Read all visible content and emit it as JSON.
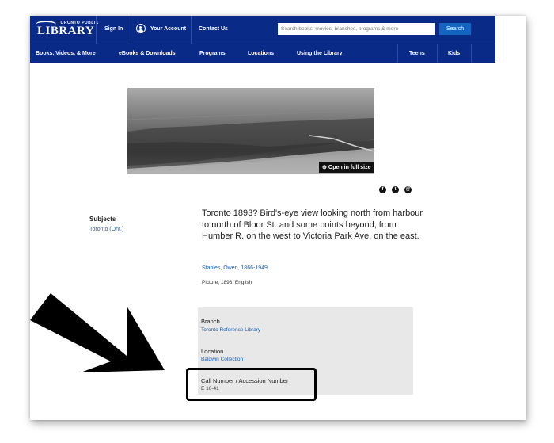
{
  "header": {
    "logo_top": "TORONTO PUBLIC",
    "logo_main": "LIBRARY",
    "sign_in": "Sign In",
    "account": "Your Account",
    "contact": "Contact Us",
    "search_placeholder": "Search books, movies, branches, programs & more",
    "search_button": "Search"
  },
  "nav": {
    "items": [
      "Books, Videos, & More",
      "eBooks & Downloads",
      "Programs",
      "Locations",
      "Using the Library",
      "Teens",
      "Kids"
    ]
  },
  "hero": {
    "fullsize_label": "Open in full size"
  },
  "record": {
    "subjects_heading": "Subjects",
    "subject_link": "Toronto (Ont.)",
    "description": "Toronto 1893? Bird's-eye view looking north from harbour to north of Bloor St. and some points beyond, from Humber R. on the west to Victoria Park Ave. on the east.",
    "author": "Staples, Owen, 1866-1949",
    "meta": "Picture, 1893, English"
  },
  "holdings": {
    "branch_label": "Branch",
    "branch_value": "Toronto Reference Library",
    "location_label": "Location",
    "location_value": "Baldwin Collection",
    "callnumber_label": "Call Number / Accession Number",
    "callnumber_value": "E 10-41"
  },
  "social": [
    "f",
    "t",
    "@"
  ],
  "colors": {
    "nav_bg": "#0a2a88",
    "link": "#1a5fb4",
    "search_button": "#1565c0"
  }
}
